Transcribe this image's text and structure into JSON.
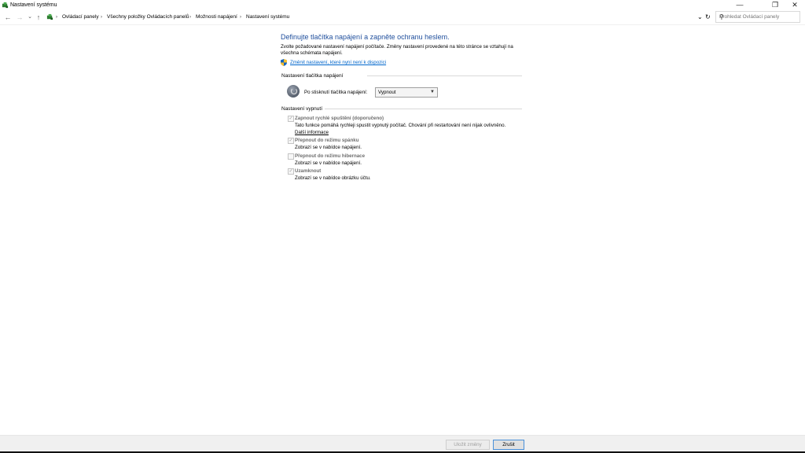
{
  "window": {
    "title": "Nastavení systému",
    "controls": {
      "minimize": "—",
      "restore": "❐",
      "close": "✕"
    }
  },
  "nav": {
    "back": "←",
    "forward": "→",
    "dropdown": "⌄",
    "up": "↑",
    "breadcrumbs": [
      "Ovládací panely",
      "Všechny položky Ovládacích panelů",
      "Možnosti napájení",
      "Nastavení systému"
    ],
    "refresh": "↻",
    "expand": "⌄",
    "search_placeholder": "Prohledat Ovládací panely",
    "search_icon": "⚲"
  },
  "main": {
    "heading": "Definujte tlačítka napájení a zapněte ochranu heslem.",
    "description": "Zvolte požadované nastavení napájení počítače. Změny nastavení provedené na této stránce se vztahují na všechna schémata napájení.",
    "change_link": "Změnit nastavení, které nyní není k dispozici",
    "power_section": {
      "title": "Nastavení tlačítka napájení",
      "label": "Po stisknutí tlačítka napájení:",
      "value": "Vypnout"
    },
    "shutdown_section": {
      "title": "Nastavení vypnutí",
      "items": [
        {
          "label": "Zapnout rychlé spuštění (doporučeno)",
          "checked": true,
          "desc": "Tato funkce pomáhá rychleji spustit vypnutý počítač. Chování při restartování není nijak ovlivněno.",
          "link": "Další informace"
        },
        {
          "label": "Přepnout do režimu spánku",
          "checked": true,
          "desc": "Zobrazí se v nabídce napájení."
        },
        {
          "label": "Přepnout do režimu hibernace",
          "checked": false,
          "desc": "Zobrazí se v nabídce napájení."
        },
        {
          "label": "Uzamknout",
          "checked": true,
          "desc": "Zobrazí se v nabídce obrázku účtu."
        }
      ]
    }
  },
  "footer": {
    "save": "Uložit změny",
    "cancel": "Zrušit"
  }
}
